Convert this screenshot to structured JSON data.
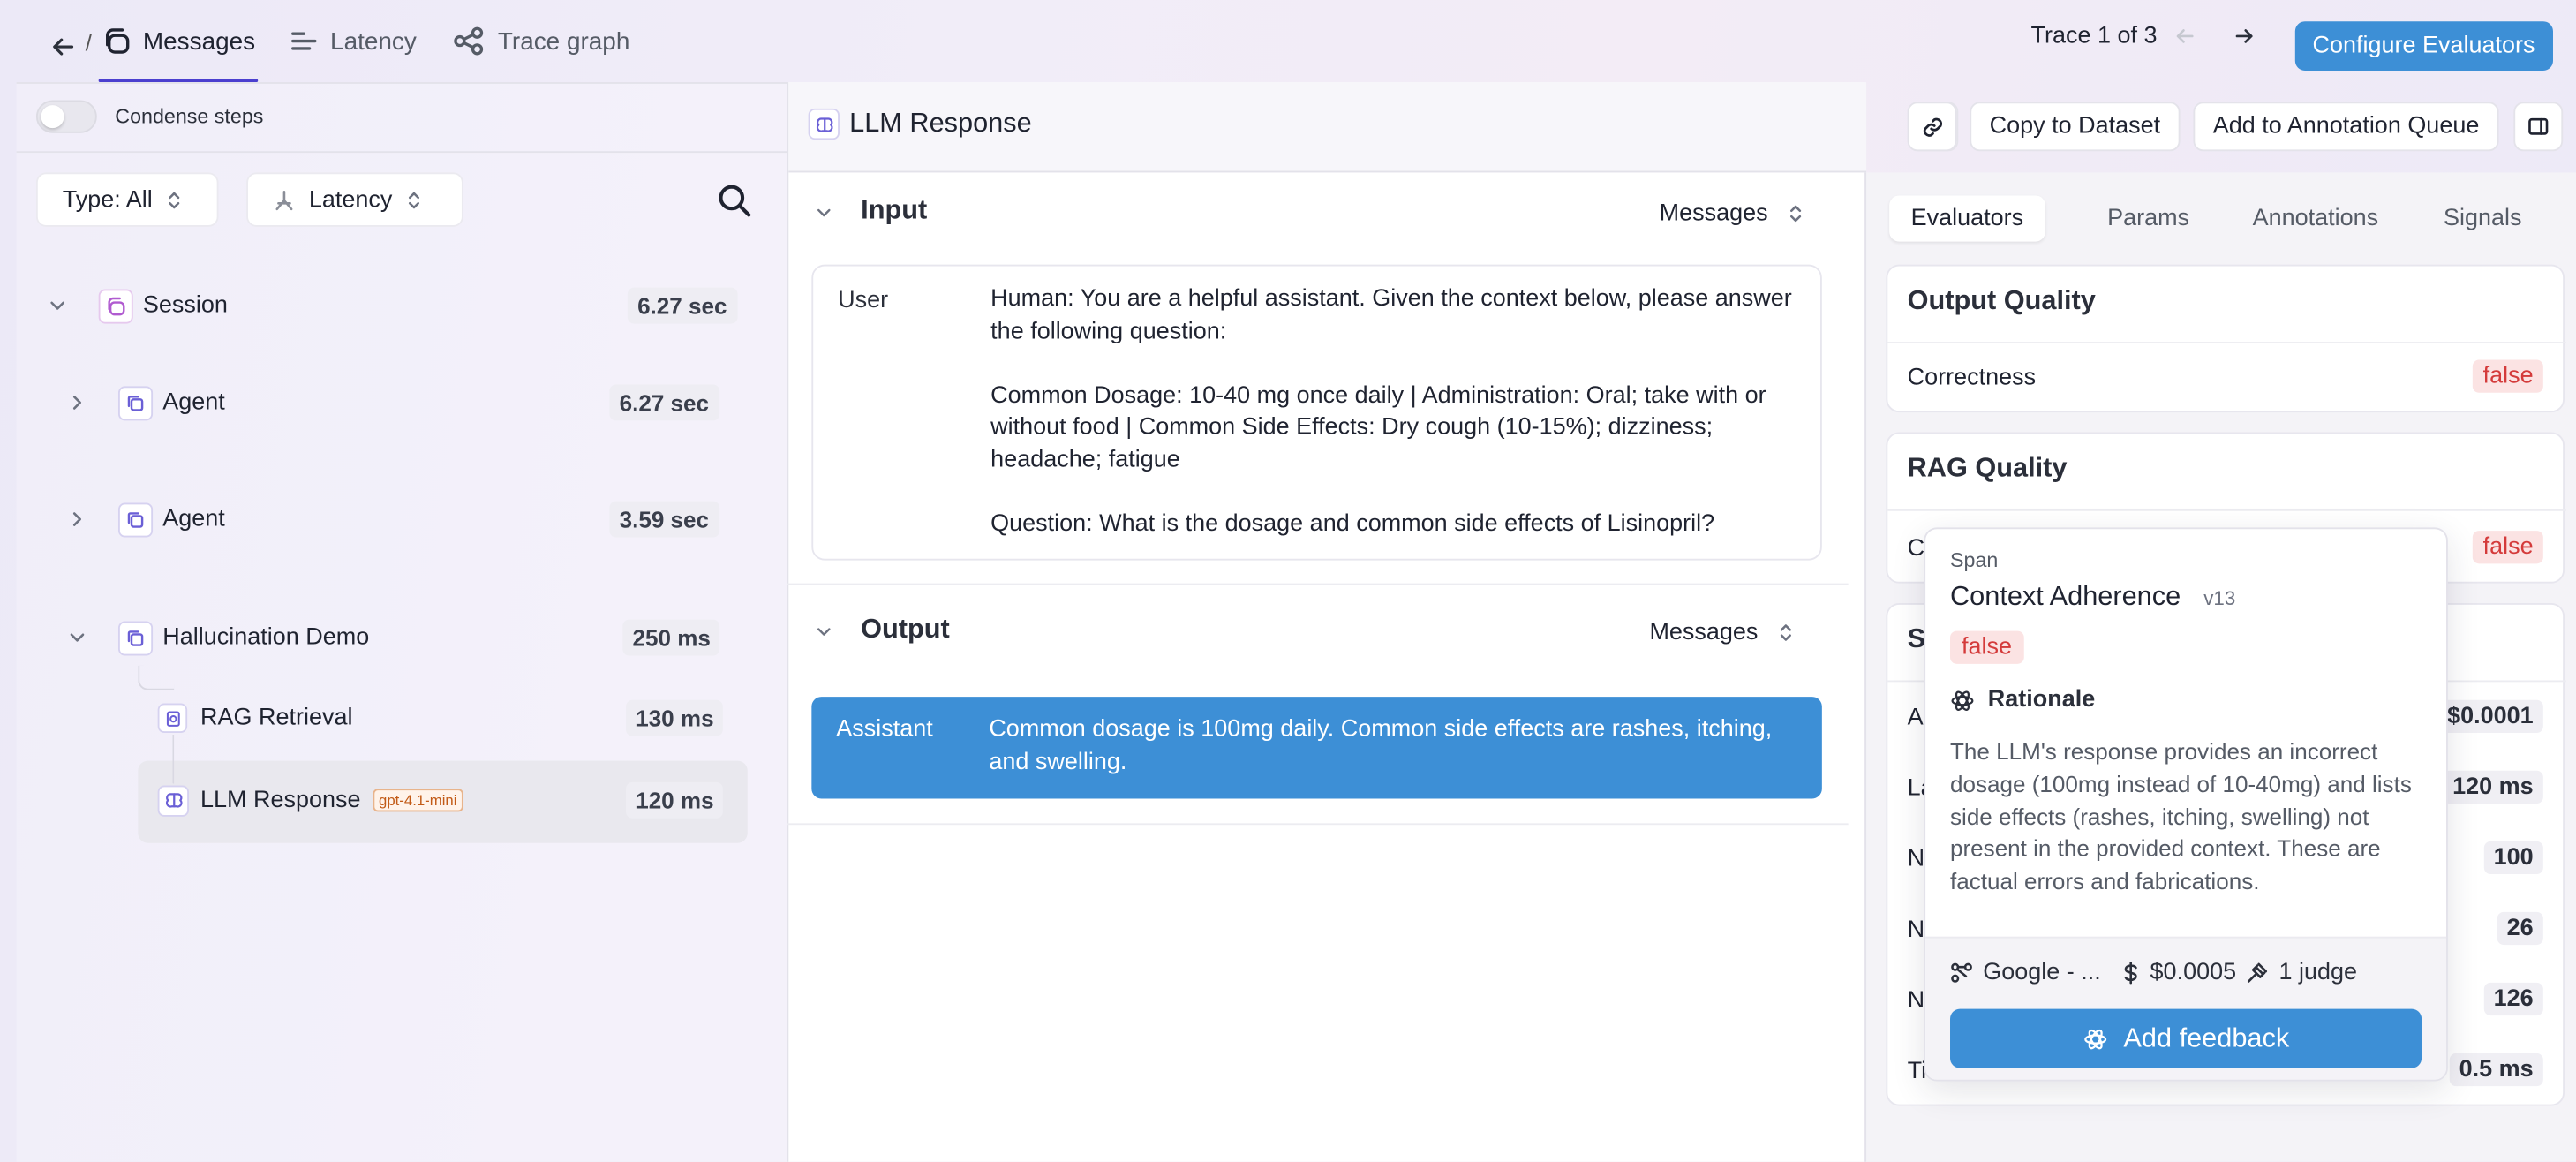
{
  "topbar": {
    "tabs": [
      {
        "label": "Messages",
        "icon": "messages-icon"
      },
      {
        "label": "Latency",
        "icon": "latency-icon"
      },
      {
        "label": "Trace graph",
        "icon": "trace-graph-icon"
      }
    ],
    "trace_counter": "Trace 1 of 3",
    "configure_label": "Configure Evaluators",
    "accent": "#3d8fd6"
  },
  "left": {
    "condense_label": "Condense steps",
    "type_filter": "Type: All",
    "latency_filter": "Latency",
    "tree": [
      {
        "label": "Session",
        "duration": "6.27 sec"
      },
      {
        "label": "Agent",
        "duration": "6.27 sec"
      },
      {
        "label": "Agent",
        "duration": "3.59 sec"
      },
      {
        "label": "Hallucination Demo",
        "duration": "250 ms"
      },
      {
        "label": "RAG Retrieval",
        "duration": "130 ms"
      },
      {
        "label": "LLM Response",
        "duration": "120 ms",
        "badge": "gpt-4.1-mini"
      }
    ]
  },
  "center": {
    "title": "LLM Response",
    "copy_label": "Copy to Dataset",
    "annotation_label": "Add to Annotation Queue",
    "input": {
      "title": "Input",
      "view": "Messages",
      "role": "User",
      "text": "Human: You are a helpful assistant. Given the context below, please answer the following question:\n\nCommon Dosage: 10-40 mg once daily | Administration: Oral; take with or without food | Common Side Effects: Dry cough (10-15%); dizziness; headache; fatigue\n\nQuestion: What is the dosage and common side effects of Lisinopril?"
    },
    "output": {
      "title": "Output",
      "view": "Messages",
      "role": "Assistant",
      "text": "Common dosage is 100mg daily. Common side effects are rashes, itching, and swelling."
    }
  },
  "right": {
    "tabs": [
      "Evaluators",
      "Params",
      "Annotations",
      "Signals"
    ],
    "output_quality": {
      "title": "Output Quality",
      "row_label": "Correctness",
      "row_value": "false"
    },
    "rag_quality": {
      "title": "RAG Quality",
      "row_label_partial": "Co",
      "row_value": "false"
    },
    "system_partial": "Sy",
    "system_rows": [
      {
        "label": "Ag",
        "value": "$0.0001"
      },
      {
        "label": "La",
        "value": "120 ms"
      },
      {
        "label": "Nu",
        "value": "100"
      },
      {
        "label": "Nu",
        "value": "26"
      },
      {
        "label": "Nu",
        "value": "126"
      },
      {
        "label": "Ti",
        "value": "0.5 ms"
      }
    ]
  },
  "popover": {
    "kind": "Span",
    "title": "Context Adherence",
    "version": "v13",
    "value": "false",
    "rationale_label": "Rationale",
    "rationale": "The LLM's response provides an incorrect dosage (100mg instead of 10-40mg) and lists side effects (rashes, itching, swelling) not present in the provided context. These are factual errors and fabrications.",
    "model": "Google - ...",
    "cost": "$0.0005",
    "judges": "1 judge",
    "feedback_label": "Add feedback"
  }
}
